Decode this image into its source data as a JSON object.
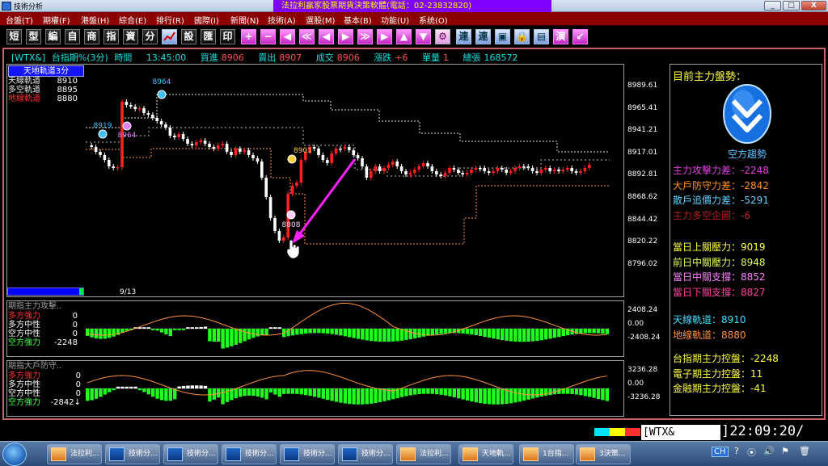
{
  "window": {
    "app_title": "技術分析",
    "banner_title": "法拉利贏家股票期貨決策軟體(電話：02-23832820)",
    "buttons": [
      "_",
      "□",
      "X"
    ]
  },
  "menu": [
    "台盤(T)",
    "期權(F)",
    "港盤(H)",
    "綜合(E)",
    "排行(R)",
    "國際(I)",
    "新聞(N)",
    "技術(A)",
    "選股(M)",
    "基本(B)",
    "功能(U)",
    "系统(O)"
  ],
  "toolbar": {
    "text_buttons": [
      "短",
      "型",
      "編",
      "自",
      "商",
      "指",
      "資",
      "分"
    ],
    "text_buttons_2": [
      "設",
      "匯",
      "印"
    ],
    "text_buttons_3": [
      "連",
      "連"
    ],
    "glyph_buttons": [
      "+",
      "−",
      "◀",
      "≪",
      "◀",
      "▶",
      "≫",
      "▶",
      "▲",
      "▼",
      "⚙"
    ],
    "extra_buttons": [
      "▣",
      "🔒",
      "▤",
      "演",
      "↙"
    ]
  },
  "quote_line": {
    "symbol": "[WTX&]",
    "name": "台指期%(3分)",
    "time_label": "時間",
    "time": "13:45:00",
    "bid_label": "買進",
    "bid": "8906",
    "ask_label": "賣出",
    "ask": "8907",
    "trade_label": "成交",
    "trade": "8906",
    "chg_label": "漲跌",
    "chg": "+6",
    "vol_label": "單量",
    "vol": "1",
    "total_label": "總張",
    "total": "168572"
  },
  "main_chart": {
    "legend_title": "天地軌道3分",
    "legend": [
      {
        "label": "天線軌道",
        "value": "8910",
        "color": "#e8e8e8"
      },
      {
        "label": "多空軌道",
        "value": "8895",
        "color": "#e8e8e8"
      },
      {
        "label": "地線軌道",
        "value": "8880",
        "color": "#ff3030"
      }
    ],
    "yticks": [
      "8989.61",
      "8965.41",
      "8941.21",
      "8917.01",
      "8892.81",
      "8868.62",
      "8844.42",
      "8820.22",
      "8796.02"
    ],
    "date_label": "9/13",
    "markers": [
      {
        "label": "8964",
        "color": "#40c0ff"
      },
      {
        "label": "8919",
        "color": "#40c0ff"
      },
      {
        "label": "8964",
        "color": "#e080ff"
      },
      {
        "label": "8901",
        "color": "#ffd040"
      },
      {
        "label": "8808",
        "color": "#ffd0ff"
      }
    ]
  },
  "sub1": {
    "title": "期指主力攻擊..",
    "rows": [
      {
        "label": "多方強力",
        "value": "0",
        "color": "#ff3030"
      },
      {
        "label": "多方中性",
        "value": "0",
        "color": "#ffffff"
      },
      {
        "label": "空方中性",
        "value": "0",
        "color": "#ffffff"
      },
      {
        "label": "空方強力",
        "value": "-2248",
        "color": "#40ff40"
      }
    ],
    "yticks": [
      "2408.24",
      "0.00",
      "-2408.24"
    ]
  },
  "sub2": {
    "title": "期指大戶防守..",
    "rows": [
      {
        "label": "多方強力",
        "value": "0",
        "color": "#ff3030"
      },
      {
        "label": "多方中性",
        "value": "0",
        "color": "#ffffff"
      },
      {
        "label": "空方中性",
        "value": "0",
        "color": "#ffffff"
      },
      {
        "label": "空方強力",
        "value": "-2842↓",
        "color": "#40ff40"
      }
    ],
    "yticks": [
      "3236.28",
      "0.00",
      "-3236.28"
    ]
  },
  "side": {
    "header": "目前主力盤勢：",
    "trend": "空方趨勢",
    "group1": [
      {
        "text": "主力攻擊力差：-2248",
        "color": "#e040e0"
      },
      {
        "text": "大戶防守力差：-2842",
        "color": "#ff9020"
      },
      {
        "text": "散戶追價力差：-5291",
        "color": "#60d0ff"
      },
      {
        "text": "主力多空企圖：-6",
        "color": "#b02020"
      }
    ],
    "group2": [
      {
        "text": "當日上關壓力：9019",
        "color": "#ffff40"
      },
      {
        "text": "前日中關壓力：8948",
        "color": "#e0ff60"
      },
      {
        "text": "當日中關支撐：8852",
        "color": "#ff80ff"
      },
      {
        "text": "當日下關支撐：8827",
        "color": "#ff40a0"
      }
    ],
    "group3": [
      {
        "text": "天線軌道：8910",
        "color": "#40e0ff"
      },
      {
        "text": "地線軌道：8880",
        "color": "#ff9040"
      }
    ],
    "group4": [
      {
        "text": "台指期主力控盤：-2248",
        "color": "#ffff40"
      },
      {
        "text": "電子期主力控盤：11",
        "color": "#ffff40"
      },
      {
        "text": "金融期主力控盤：-41",
        "color": "#ffff40"
      }
    ]
  },
  "status": {
    "symbol": "[WTX&",
    "clock": "]22:09:20/"
  },
  "taskbar": [
    {
      "label": "法拉利...",
      "type": "or"
    },
    {
      "label": "技術分...",
      "type": "bl"
    },
    {
      "label": "技術分...",
      "type": "bl"
    },
    {
      "label": "技術分...",
      "type": "bl"
    },
    {
      "label": "技術分...",
      "type": "bl"
    },
    {
      "label": "技術分...",
      "type": "bl"
    },
    {
      "label": "法拉利...",
      "type": "or"
    },
    {
      "label": "天地軌...",
      "type": "or"
    },
    {
      "label": "1台指...",
      "type": "or"
    },
    {
      "label": "3決策...",
      "type": "or"
    }
  ],
  "tray": {
    "lang": "CH",
    "icons": [
      "?",
      "⦿",
      "🔊",
      "⚑",
      "🗑"
    ]
  },
  "colors": {
    "up": "#ff2020",
    "down": "#ffffff",
    "sky": "#e0e0e0",
    "earth": "#ff9040",
    "arrow": "#ff20ff",
    "bar_neg": "#20ff20",
    "bar_pos": "#ffffff"
  }
}
